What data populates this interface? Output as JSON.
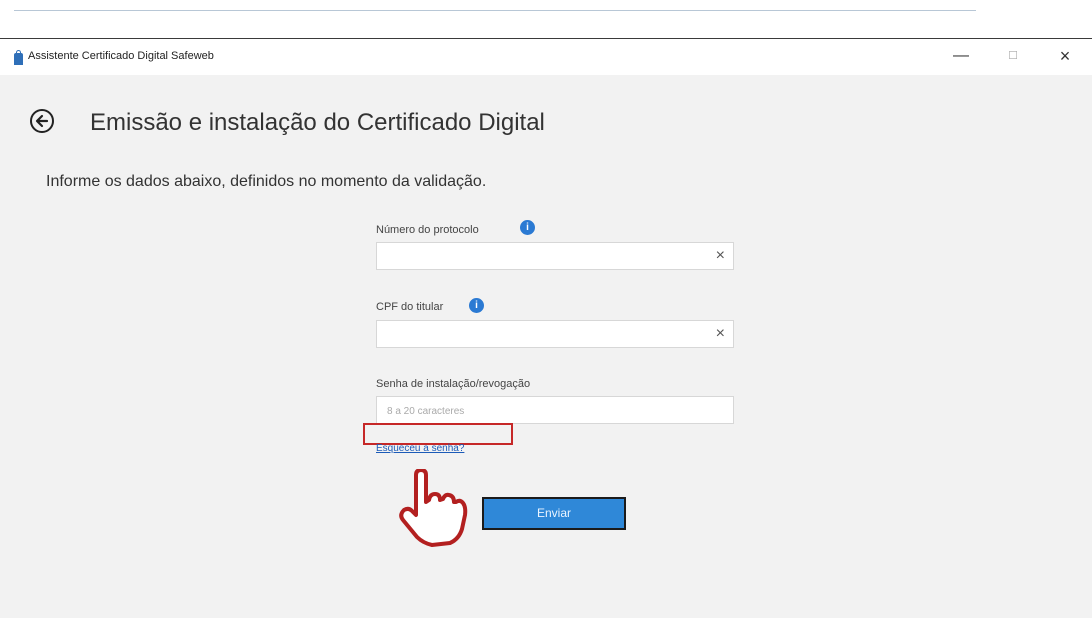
{
  "window": {
    "title": "Assistente Certificado Digital Safeweb",
    "minimize_icon": "minimize-icon",
    "maximize_icon": "maximize-icon",
    "close_icon": "close-icon"
  },
  "header": {
    "back_icon": "arrow-left-icon",
    "title": "Emissão e instalação do Certificado Digital"
  },
  "main": {
    "instructions": "Informe os dados abaixo, definidos no momento da validação.",
    "fields": [
      {
        "label": "Número do protocolo",
        "value": "",
        "info_icon": "info-icon",
        "clear_icon": "close-icon"
      },
      {
        "label": "CPF do titular",
        "value": "",
        "info_icon": "info-icon",
        "clear_icon": "close-icon"
      },
      {
        "label": "Senha de instalação/revogação",
        "value": "",
        "placeholder": "8 a 20 caracteres"
      }
    ],
    "forgot_password_link": "Esqueceu a senha?",
    "submit_label": "Enviar"
  },
  "annotations": {
    "highlight_color": "#c62828",
    "hand_icon": "pointing-hand-icon"
  },
  "colors": {
    "accent": "#2f88d8",
    "link": "#1c5bb8",
    "background": "#f2f2f2"
  }
}
